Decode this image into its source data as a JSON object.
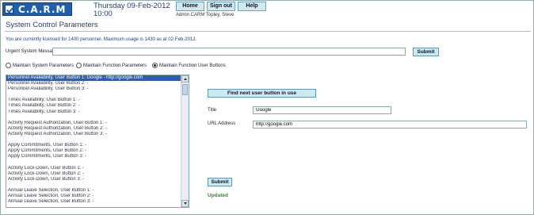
{
  "header": {
    "logo_text": "C.A.R.M",
    "date": "Thursday 09-Feb-2012",
    "time": "10:00",
    "nav": [
      "Home",
      "Sign out",
      "Help"
    ],
    "admin": "Admin CARM Topley, Steve"
  },
  "page_title": "System Control Parameters",
  "license_text": "You are currently licensed for 1400 personnel. Maximum usage is 1430 as at 02-Feb-2012.",
  "urgent": {
    "label": "Urgent System Message",
    "value": "",
    "submit": "Submit"
  },
  "modes": [
    {
      "label": "Maintain System Parameters",
      "selected": false
    },
    {
      "label": "Maintain Function Parameters",
      "selected": false
    },
    {
      "label": "Maintain Function User Buttons",
      "selected": true
    }
  ],
  "list": [
    "Personnel Availability, User Button 1: Google - http://google.com",
    "Personnel Availability, User Button 2: -",
    "Personnel Availability, User Button 3: -",
    "",
    "Times Availability, User Button 1: -",
    "Times Availability, User Button 2: -",
    "Times Availability, User Button 3: -",
    "",
    "Activity Request Authorization, User Button 1: -",
    "Activity Request Authorization, User Button 2: -",
    "Activity Request Authorization, User Button 3: -",
    "",
    "Apply Commitments, User Button 1: -",
    "Apply Commitments, User Button 2: -",
    "Apply Commitments, User Button 3: -",
    "",
    "Activity Lock-Down, User Button 1: -",
    "Activity Lock-Down, User Button 2: -",
    "Activity Lock-Down, User Button 3: -",
    "",
    "Annual Leave Selection, User Button 1: -",
    "Annual Leave Selection, User Button 2: -",
    "Annual Leave Selection, User Button 3: -"
  ],
  "right": {
    "find_next": "Find next user button in use",
    "title_label": "Title",
    "title_value": "Google",
    "url_label": "URL Address",
    "url_value": "http://google.com",
    "submit": "Submit",
    "status": "Updated"
  }
}
